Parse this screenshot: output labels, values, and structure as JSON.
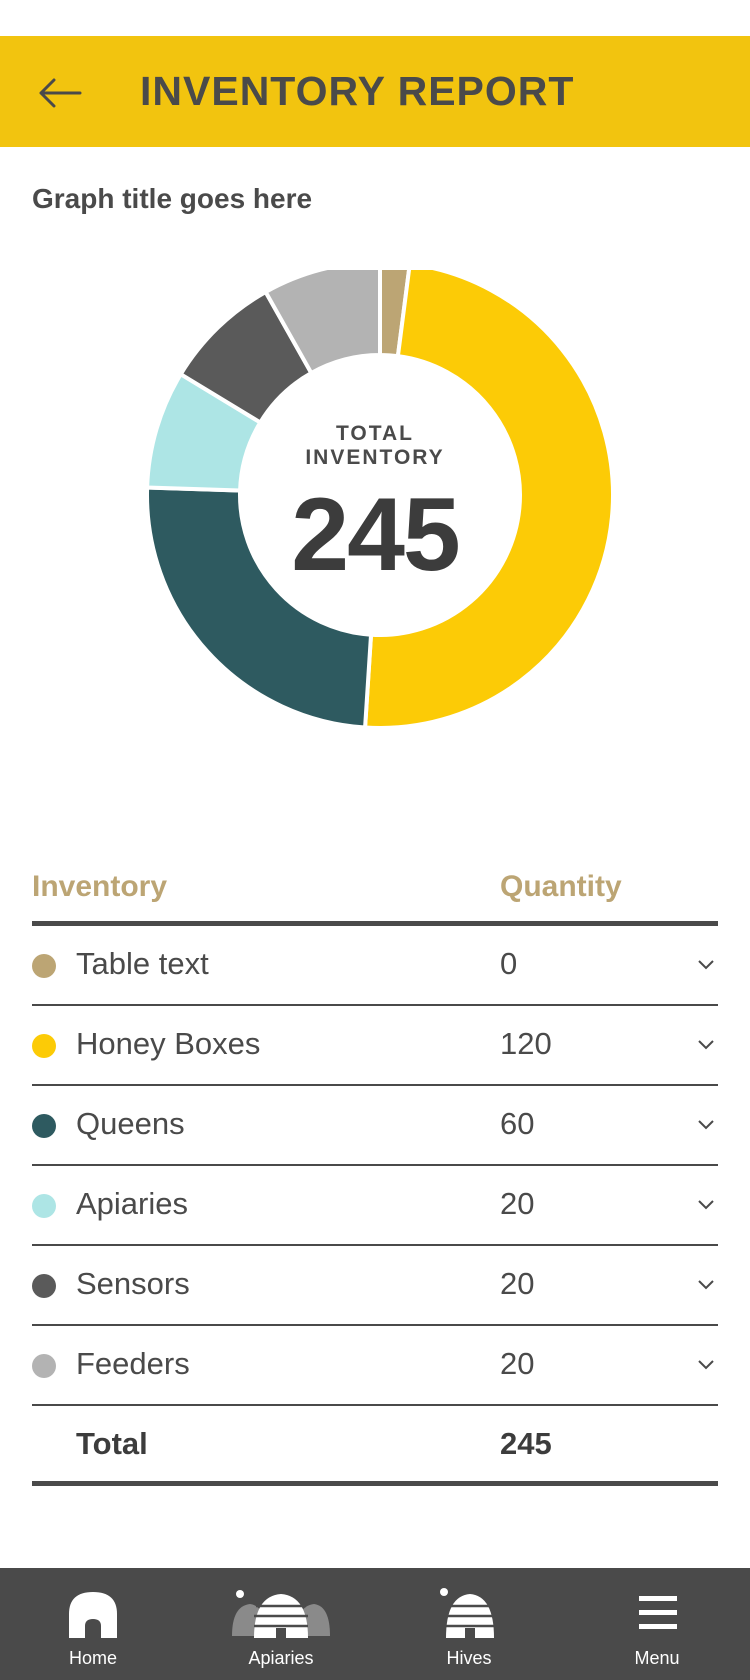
{
  "header": {
    "title": "INVENTORY REPORT"
  },
  "graph": {
    "title": "Graph title goes here"
  },
  "center": {
    "label_line1": "TOTAL",
    "label_line2": "INVENTORY",
    "value": "245"
  },
  "table": {
    "headers": {
      "inventory": "Inventory",
      "quantity": "Quantity"
    },
    "rows": [
      {
        "name": "Table text",
        "qty": "0",
        "color": "#bca574"
      },
      {
        "name": "Honey Boxes",
        "qty": "120",
        "color": "#fccb06"
      },
      {
        "name": "Queens",
        "qty": "60",
        "color": "#2e5a60"
      },
      {
        "name": "Apiaries",
        "qty": "20",
        "color": "#ade5e5"
      },
      {
        "name": "Sensors",
        "qty": "20",
        "color": "#5a5a5a"
      },
      {
        "name": "Feeders",
        "qty": "20",
        "color": "#b3b3b3"
      }
    ],
    "total": {
      "label": "Total",
      "value": "245"
    }
  },
  "chart_data": {
    "type": "pie",
    "categories": [
      "Table text",
      "Honey Boxes",
      "Queens",
      "Apiaries",
      "Sensors",
      "Feeders"
    ],
    "values": [
      5,
      120,
      60,
      20,
      20,
      20
    ],
    "colors": [
      "#bca574",
      "#fccb06",
      "#2e5a60",
      "#ade5e5",
      "#5a5a5a",
      "#b3b3b3"
    ],
    "title": "Graph title goes here"
  },
  "nav": {
    "items": [
      {
        "label": "Home",
        "icon": "home-icon"
      },
      {
        "label": "Apiaries",
        "icon": "apiaries-icon"
      },
      {
        "label": "Hives",
        "icon": "hive-icon"
      },
      {
        "label": "Menu",
        "icon": "menu-icon"
      }
    ]
  },
  "colors": {
    "accent": "#f2c40f",
    "dark": "#4a4a4a",
    "gold": "#bca574"
  }
}
